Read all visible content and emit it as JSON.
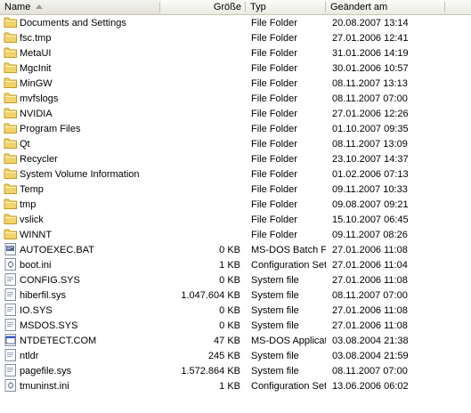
{
  "columns": {
    "name": "Name",
    "size": "Größe",
    "type": "Typ",
    "modified": "Geändert am"
  },
  "colors": {
    "folder": "#f2d36b",
    "folder_edge": "#c69b1e",
    "file_page": "#ffffff",
    "file_edge": "#7e8ca0"
  },
  "rows": [
    {
      "name": "Documents and Settings",
      "size": "",
      "type": "File Folder",
      "modified": "20.08.2007 13:14",
      "icon": "folder-icon"
    },
    {
      "name": "fsc.tmp",
      "size": "",
      "type": "File Folder",
      "modified": "27.01.2006 12:41",
      "icon": "folder-icon"
    },
    {
      "name": "MetaUI",
      "size": "",
      "type": "File Folder",
      "modified": "31.01.2006 14:19",
      "icon": "folder-icon"
    },
    {
      "name": "MgcInit",
      "size": "",
      "type": "File Folder",
      "modified": "30.01.2006 10:57",
      "icon": "folder-icon"
    },
    {
      "name": "MinGW",
      "size": "",
      "type": "File Folder",
      "modified": "08.11.2007 13:13",
      "icon": "folder-icon"
    },
    {
      "name": "mvfslogs",
      "size": "",
      "type": "File Folder",
      "modified": "08.11.2007 07:00",
      "icon": "folder-icon"
    },
    {
      "name": "NVIDIA",
      "size": "",
      "type": "File Folder",
      "modified": "27.01.2006 12:26",
      "icon": "folder-icon"
    },
    {
      "name": "Program Files",
      "size": "",
      "type": "File Folder",
      "modified": "01.10.2007 09:35",
      "icon": "folder-icon"
    },
    {
      "name": "Qt",
      "size": "",
      "type": "File Folder",
      "modified": "08.11.2007 13:09",
      "icon": "folder-icon"
    },
    {
      "name": "Recycler",
      "size": "",
      "type": "File Folder",
      "modified": "23.10.2007 14:37",
      "icon": "folder-icon"
    },
    {
      "name": "System Volume Information",
      "size": "",
      "type": "File Folder",
      "modified": "01.02.2006 07:13",
      "icon": "folder-icon"
    },
    {
      "name": "Temp",
      "size": "",
      "type": "File Folder",
      "modified": "09.11.2007 10:33",
      "icon": "folder-icon"
    },
    {
      "name": "tmp",
      "size": "",
      "type": "File Folder",
      "modified": "09.08.2007 09:21",
      "icon": "folder-icon"
    },
    {
      "name": "vslick",
      "size": "",
      "type": "File Folder",
      "modified": "15.10.2007 06:45",
      "icon": "folder-icon"
    },
    {
      "name": "WINNT",
      "size": "",
      "type": "File Folder",
      "modified": "09.11.2007 08:26",
      "icon": "folder-icon"
    },
    {
      "name": "AUTOEXEC.BAT",
      "size": "0 KB",
      "type": "MS-DOS Batch File",
      "modified": "27.01.2006 11:08",
      "icon": "batch-file-icon"
    },
    {
      "name": "boot.ini",
      "size": "1 KB",
      "type": "Configuration Settings",
      "modified": "27.01.2006 11:04",
      "icon": "settings-file-icon"
    },
    {
      "name": "CONFIG.SYS",
      "size": "0 KB",
      "type": "System file",
      "modified": "27.01.2006 11:08",
      "icon": "system-file-icon"
    },
    {
      "name": "hiberfil.sys",
      "size": "1.047.604 KB",
      "type": "System file",
      "modified": "08.11.2007 07:00",
      "icon": "system-file-icon"
    },
    {
      "name": "IO.SYS",
      "size": "0 KB",
      "type": "System file",
      "modified": "27.01.2006 11:08",
      "icon": "system-file-icon"
    },
    {
      "name": "MSDOS.SYS",
      "size": "0 KB",
      "type": "System file",
      "modified": "27.01.2006 11:08",
      "icon": "system-file-icon"
    },
    {
      "name": "NTDETECT.COM",
      "size": "47 KB",
      "type": "MS-DOS Application",
      "modified": "03.08.2004 21:38",
      "icon": "application-file-icon"
    },
    {
      "name": "ntldr",
      "size": "245 KB",
      "type": "System file",
      "modified": "03.08.2004 21:59",
      "icon": "system-file-icon"
    },
    {
      "name": "pagefile.sys",
      "size": "1.572.864 KB",
      "type": "System file",
      "modified": "08.11.2007 07:00",
      "icon": "system-file-icon"
    },
    {
      "name": "tmuninst.ini",
      "size": "1 KB",
      "type": "Configuration Settings",
      "modified": "13.06.2006 06:02",
      "icon": "settings-file-icon"
    }
  ]
}
